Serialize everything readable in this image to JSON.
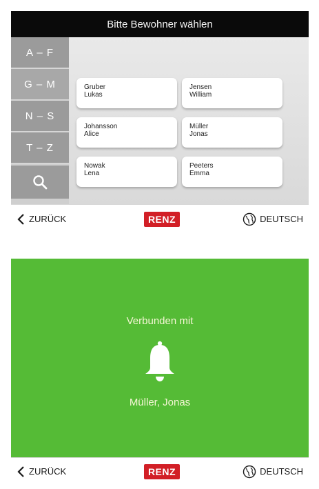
{
  "screen1": {
    "title": "Bitte Bewohner wählen",
    "alphabet": [
      "A – F",
      "G – M",
      "N – S",
      "T – Z"
    ],
    "search_icon": "search-icon",
    "residents": [
      {
        "last": "Gruber",
        "first": "Lukas"
      },
      {
        "last": "Jensen",
        "first": "William"
      },
      {
        "last": "Johansson",
        "first": "Alice"
      },
      {
        "last": "Müller",
        "first": "Jonas"
      },
      {
        "last": "Nowak",
        "first": "Lena"
      },
      {
        "last": "Peeters",
        "first": "Emma"
      }
    ]
  },
  "screen2": {
    "status": "Verbunden mit",
    "icon": "bell-icon",
    "name": "Müller, Jonas"
  },
  "footer": {
    "back_label": "ZURÜCK",
    "logo": "RENZ",
    "language_label": "DEUTSCH"
  },
  "colors": {
    "header_bg": "#0a0a0a",
    "sidebar_button": "#9b9b9b",
    "connected_green": "#55bb36",
    "logo_red": "#d21f26"
  }
}
